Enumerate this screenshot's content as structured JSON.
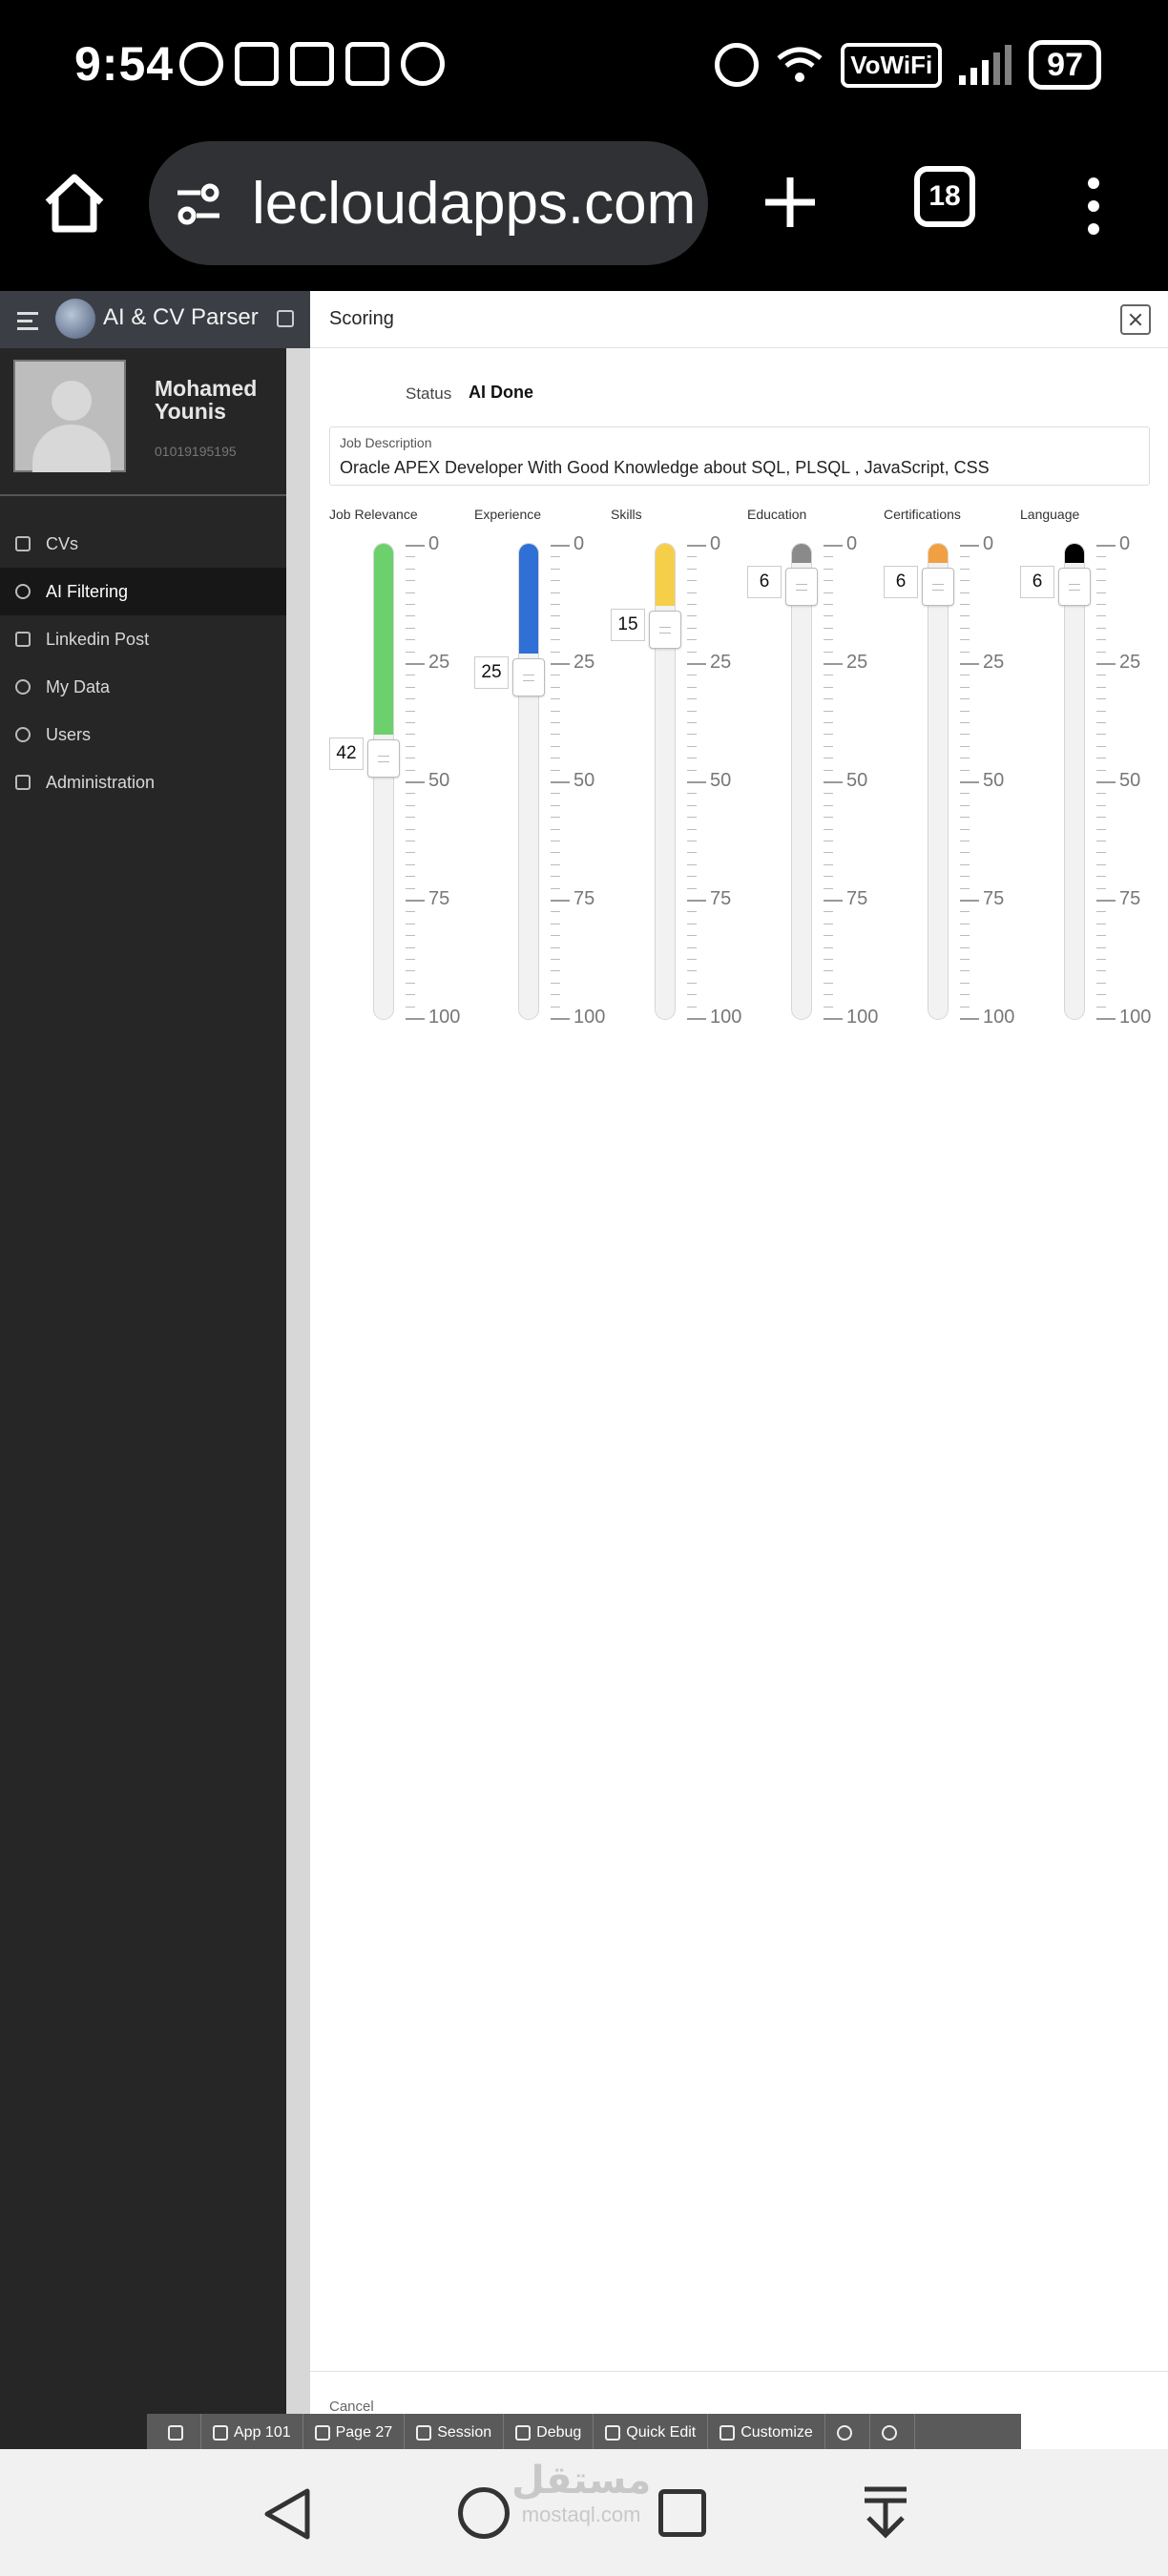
{
  "status_bar": {
    "time": "9:54",
    "vowifi": "VoWiFi",
    "battery": "97",
    "icons": [
      "whatsapp-icon",
      "heart-rate-icon",
      "heart-rate-icon",
      "gmail-icon",
      "mosque-icon",
      "alarm-icon",
      "wifi-icon",
      "signal-icon"
    ]
  },
  "browser": {
    "url": "lecloudapps.com",
    "tab_count": "18"
  },
  "app": {
    "title": "AI & CV Parser",
    "user": {
      "name": "Mohamed Younis",
      "phone": "01019195195"
    },
    "nav": [
      {
        "label": "CVs",
        "icon": "document-icon",
        "active": false
      },
      {
        "label": "AI Filtering",
        "icon": "ai-icon",
        "active": true
      },
      {
        "label": "Linkedin Post",
        "icon": "post-icon",
        "active": false
      },
      {
        "label": "My Data",
        "icon": "user-circle-icon",
        "active": false
      },
      {
        "label": "Users",
        "icon": "users-icon",
        "active": false
      },
      {
        "label": "Administration",
        "icon": "admin-icon",
        "active": false
      }
    ]
  },
  "dialog": {
    "title": "Scoring",
    "status_label": "Status",
    "status_value": "AI Done",
    "job_description_label": "Job Description",
    "job_description_value": "Oracle APEX Developer With Good Knowledge about SQL, PLSQL , JavaScript, CSS",
    "scale": {
      "ticks": [
        "0",
        "25",
        "50",
        "75",
        "100"
      ]
    },
    "sliders": [
      {
        "label": "Job Relevance",
        "value": 42,
        "color": "#6cd06c"
      },
      {
        "label": "Experience",
        "value": 25,
        "color": "#2f6fd6"
      },
      {
        "label": "Skills",
        "value": 15,
        "color": "#f5cf4a"
      },
      {
        "label": "Education",
        "value": 6,
        "color": "#8a8a8a"
      },
      {
        "label": "Certifications",
        "value": 6,
        "color": "#f0a040"
      },
      {
        "label": "Language",
        "value": 6,
        "color": "#000000"
      }
    ],
    "cancel_label": "Cancel"
  },
  "dev_toolbar": [
    {
      "label": "",
      "icon": "home-icon"
    },
    {
      "label": "App 101",
      "icon": "edit-icon"
    },
    {
      "label": "Page 27",
      "icon": "page-edit-icon"
    },
    {
      "label": "Session",
      "icon": "session-icon"
    },
    {
      "label": "Debug",
      "icon": "bug-icon"
    },
    {
      "label": "Quick Edit",
      "icon": "quick-edit-icon"
    },
    {
      "label": "Customize",
      "icon": "paint-icon"
    },
    {
      "label": "",
      "icon": "info-icon"
    },
    {
      "label": "",
      "icon": "gear-icon"
    }
  ],
  "watermark": {
    "arabic": "مستقل",
    "latin": "mostaql.com"
  }
}
